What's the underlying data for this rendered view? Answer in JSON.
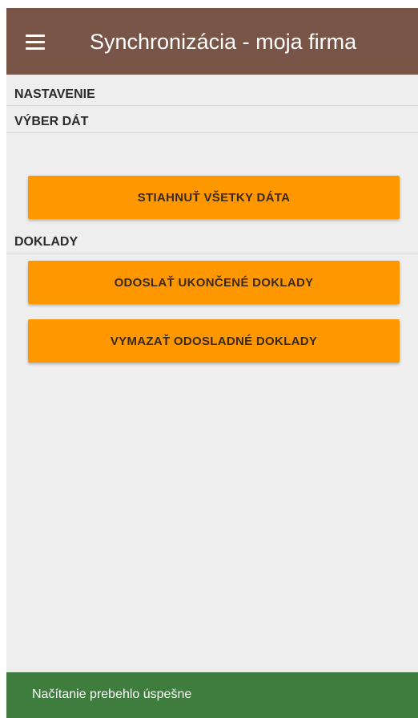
{
  "app_bar": {
    "title": "Synchronizácia - moja firma",
    "menu_icon": "hamburger-menu-icon",
    "background_color": "#795548"
  },
  "sections": {
    "settings_label": "NASTAVENIE",
    "data_selection_label": "VÝBER DÁT",
    "documents_label": "DOKLADY"
  },
  "buttons": {
    "download_all_label": "STIAHNUŤ VŠETKY DÁTA",
    "send_finished_label": "ODOSLAŤ UKONČENÉ DOKLADY",
    "delete_sent_label": "VYMAZAŤ ODOSLADNÉ DOKLADY",
    "color": "#ff9800"
  },
  "snackbar": {
    "message": "Načítanie prebehlo úspešne",
    "background_color": "#3e7d3e"
  }
}
